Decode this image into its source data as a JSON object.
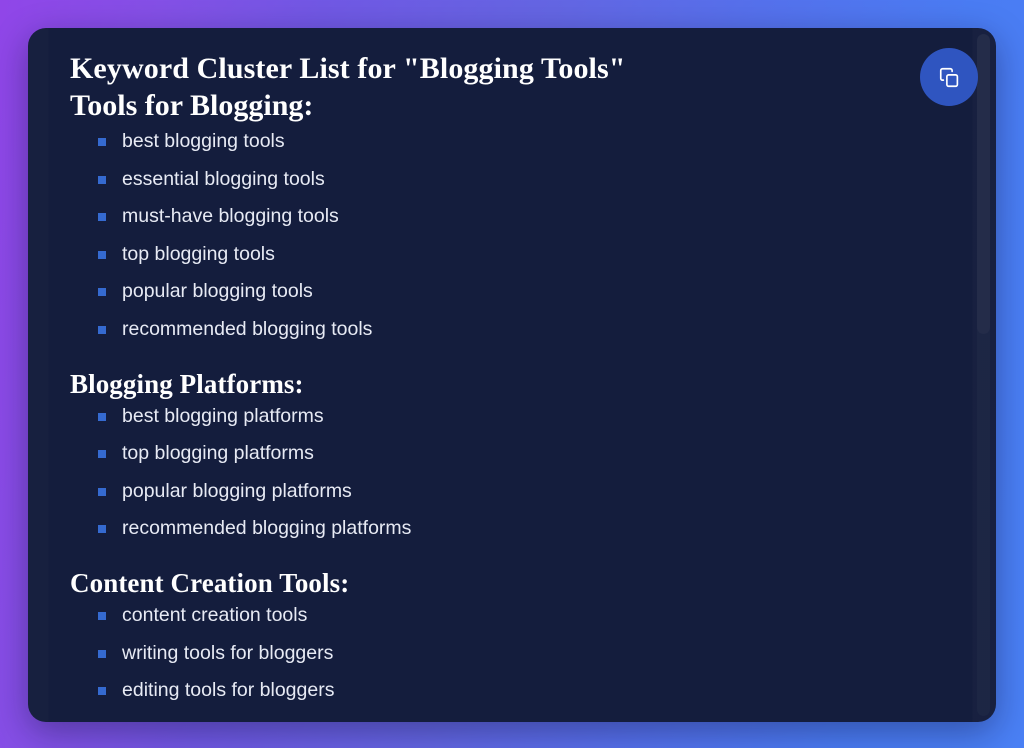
{
  "background": {
    "gradient_from": "#9046e8",
    "gradient_mid": "#6466e3",
    "gradient_to": "#4a80f5"
  },
  "card": {
    "background_color": "#141d3d",
    "accent_color": "#356ad0",
    "text_color": "#e7eaf4"
  },
  "document": {
    "title": "Keyword Cluster List for \"Blogging Tools\"",
    "subtitle": "Tools for Blogging:",
    "sections": [
      {
        "heading": "Tools for Blogging:",
        "items": [
          "best blogging tools",
          "essential blogging tools",
          "must-have blogging tools",
          "top blogging tools",
          "popular blogging tools",
          "recommended blogging tools"
        ]
      },
      {
        "heading": "Blogging Platforms:",
        "items": [
          "best blogging platforms",
          "top blogging platforms",
          "popular blogging platforms",
          "recommended blogging platforms"
        ]
      },
      {
        "heading": "Content Creation Tools:",
        "items": [
          "content creation tools",
          "writing tools for bloggers",
          "editing tools for bloggers"
        ]
      }
    ]
  },
  "toolbar": {
    "copy_button": {
      "icon": "copy-icon",
      "label": "Copy",
      "background_color": "#2f55c0"
    }
  },
  "scrollbar": {
    "orientation": "vertical",
    "thumb_color": "#22305a"
  }
}
